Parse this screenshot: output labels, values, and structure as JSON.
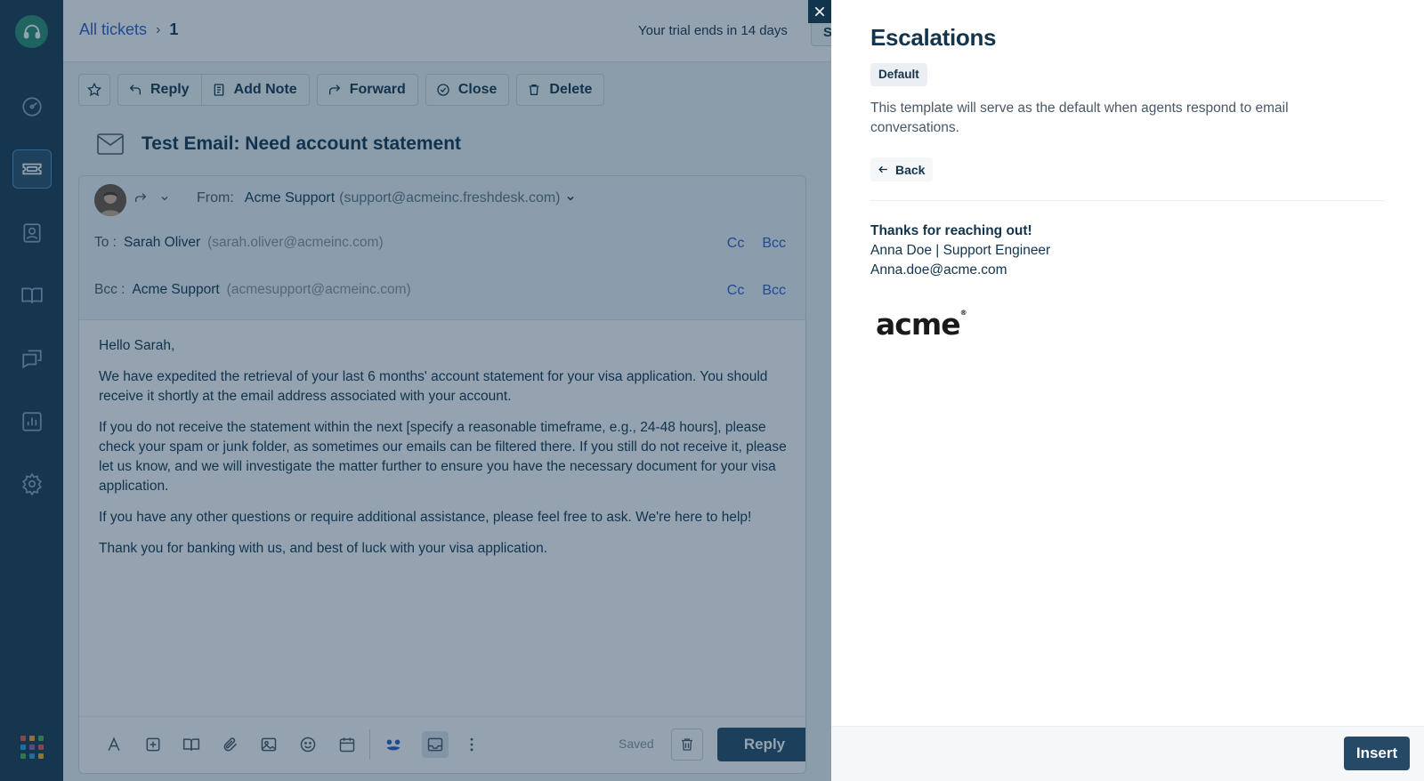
{
  "breadcrumb": {
    "all_tickets": "All tickets",
    "separator": "›",
    "ticket_number": "1"
  },
  "trial": {
    "text": "Your trial ends in 14 days",
    "button_label": "S"
  },
  "toolbar": {
    "reply": "Reply",
    "add_note": "Add Note",
    "forward": "Forward",
    "close": "Close",
    "delete": "Delete"
  },
  "ticket": {
    "subject": "Test Email: Need account statement"
  },
  "compose": {
    "from_label": "From:",
    "from_name": "Acme Support",
    "from_email": "(support@acmeinc.freshdesk.com)",
    "to_label": "To :",
    "to_name": "Sarah Oliver",
    "to_email": "(sarah.oliver@acmeinc.com)",
    "bcc_label": "Bcc :",
    "bcc_name": "Acme Support",
    "bcc_email": "(acmesupport@acmeinc.com)",
    "cc_link": "Cc",
    "bcc_link": "Bcc",
    "body": [
      "Hello Sarah,",
      "We have expedited the retrieval of your last 6 months' account statement for your visa application. You should receive it shortly at the email address associated with your account.",
      "If you do not receive the statement within the next [specify a reasonable timeframe, e.g., 24-48 hours], please check your spam or junk folder, as sometimes our emails can be filtered there. If you still do not receive it, please let us know, and we will investigate the matter further to ensure you have the necessary document for your visa application.",
      "If you have any other questions or require additional assistance, please feel free to ask. We're here to help!",
      "Thank you for banking with us, and best of luck with your visa application."
    ],
    "saved_label": "Saved",
    "reply_button": "Reply"
  },
  "panel": {
    "title": "Escalations",
    "badge": "Default",
    "description": "This template will serve as the default when agents respond to email conversations.",
    "back_button": "Back",
    "signature": {
      "line1": "Thanks for reaching out!",
      "line2": "Anna Doe | Support Engineer",
      "line3": "Anna.doe@acme.com"
    },
    "logo_text": "acme",
    "insert_button": "Insert"
  },
  "colors": {
    "nav_bg": "#1b3a52",
    "primary_button": "#264966",
    "link": "#2c5cc5",
    "logo_green": "#2a8c72"
  },
  "icons": {
    "nav": [
      "headset-logo-icon",
      "dashboard-icon",
      "tickets-icon",
      "contacts-icon",
      "knowledge-base-icon",
      "forums-icon",
      "reports-icon",
      "settings-icon",
      "apps-grid-icon"
    ]
  }
}
